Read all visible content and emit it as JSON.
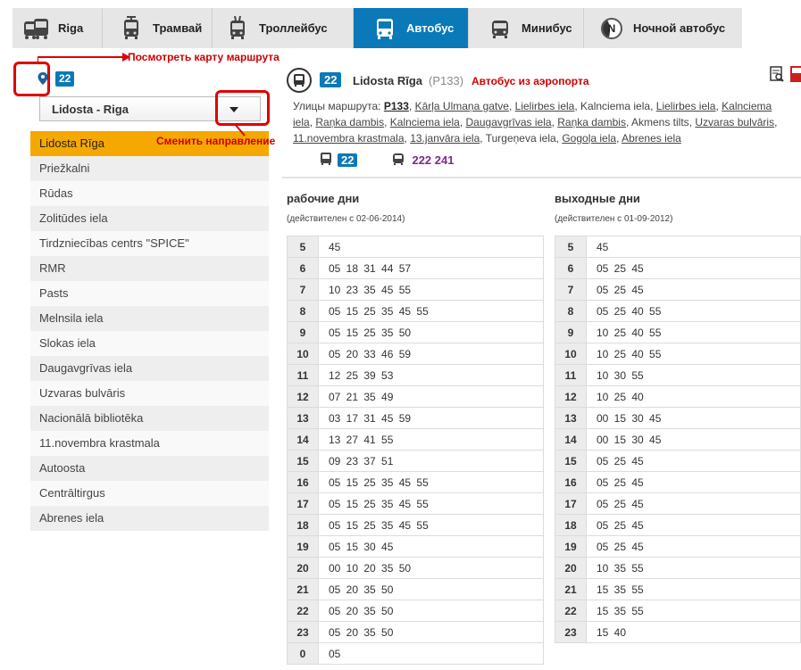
{
  "tabs": [
    {
      "label": "Riga",
      "icon": "bus-tram-icon"
    },
    {
      "label": "Трамвай",
      "icon": "tram-icon"
    },
    {
      "label": "Троллейбус",
      "icon": "trolleybus-icon"
    },
    {
      "label": "Автобус",
      "icon": "bus-icon",
      "active": true
    },
    {
      "label": "Минибус",
      "icon": "minibus-icon"
    },
    {
      "label": "Ночной автобус",
      "icon": "night-bus-icon",
      "icon_letter": "N"
    }
  ],
  "left": {
    "route_number": "22",
    "direction": "Lidosta - Riga",
    "stops": [
      "Lidosta Rīga",
      "Priežkalni",
      "Rūdas",
      "Zolitūdes iela",
      "Tirdzniecības centrs \"SPICE\"",
      "RMR",
      "Pasts",
      "Melnsila iela",
      "Slokas iela",
      "Daugavgrīvas iela",
      "Uzvaras bulvāris",
      "Nacionālā bibliotēka",
      "11.novembra krastmala",
      "Autoosta",
      "Centrāltirgus",
      "Abrenes iela"
    ],
    "active_stop": 0
  },
  "annotations": {
    "map_note": "Посмотреть карту маршрута",
    "direction_note": "Сменить направление"
  },
  "route": {
    "number": "22",
    "name": "Lidosta Rīga",
    "code": "(P133)",
    "note": "Автобус из аэропорта",
    "streets_label": "Улицы маршрута:",
    "streets_main": "P133",
    "streets": [
      {
        "text": "Kārļa Ulmaņa gatve",
        "link": true
      },
      {
        "text": "Lielirbes iela",
        "link": true
      },
      {
        "text": "Kalnciema iela",
        "link": false
      },
      {
        "text": "Lielirbes iela",
        "link": true
      },
      {
        "text": "Kalnciema iela",
        "link": true
      },
      {
        "text": "Raņka dambis",
        "link": true
      },
      {
        "text": "Kalnciema iela",
        "link": true
      },
      {
        "text": "Daugavgrīvas iela",
        "link": true
      },
      {
        "text": "Raņka dambis",
        "link": true
      },
      {
        "text": "Akmens tilts",
        "link": false
      },
      {
        "text": "Uzvaras bulvāris",
        "link": true
      },
      {
        "text": "11.novembra krastmala",
        "link": true
      },
      {
        "text": "13.janvāra iela",
        "link": true
      },
      {
        "text": "Turgeņeva iela",
        "link": false
      },
      {
        "text": "Gogoļa iela",
        "link": true
      },
      {
        "text": "Abrenes iela",
        "link": true
      }
    ],
    "transfer_bus": "22",
    "transfer_minibus": "222  241"
  },
  "colors": {
    "accent": "#0a79b8",
    "active_stop": "#f5a800",
    "alert": "#cc0000",
    "minibus": "#7b2a8c"
  },
  "weekdays": {
    "title": "рабочие дни",
    "valid": "(действителен с 02-06-2014)",
    "rows": [
      [
        "5",
        "45"
      ],
      [
        "6",
        "05 18 31 44 57"
      ],
      [
        "7",
        "10 23 35 45 55"
      ],
      [
        "8",
        "05 15 25 35 45 55"
      ],
      [
        "9",
        "05 15 25 35 50"
      ],
      [
        "10",
        "05 20 33 46 59"
      ],
      [
        "11",
        "12 25 39 53"
      ],
      [
        "12",
        "07 21 35 49"
      ],
      [
        "13",
        "03 17 31 45 59"
      ],
      [
        "14",
        "13 27 41 55"
      ],
      [
        "15",
        "09 23 37 51"
      ],
      [
        "16",
        "05 15 25 35 45 55"
      ],
      [
        "17",
        "05 15 25 35 45 55"
      ],
      [
        "18",
        "05 15 25 35 45 55"
      ],
      [
        "19",
        "05 15 30 45"
      ],
      [
        "20",
        "00 10 20 35 50"
      ],
      [
        "21",
        "05 20 35 50"
      ],
      [
        "22",
        "05 20 35 50"
      ],
      [
        "23",
        "05 20 35 50"
      ],
      [
        "0",
        "05"
      ]
    ]
  },
  "weekends": {
    "title": "выходные дни",
    "valid": "(действителен с 01-09-2012)",
    "rows": [
      [
        "5",
        "45"
      ],
      [
        "6",
        "05 25 45"
      ],
      [
        "7",
        "05 25 45"
      ],
      [
        "8",
        "05 25 40 55"
      ],
      [
        "9",
        "10 25 40 55"
      ],
      [
        "10",
        "10 25 40 55"
      ],
      [
        "11",
        "10 30 55"
      ],
      [
        "12",
        "10 25 40"
      ],
      [
        "13",
        "00 15 30 45"
      ],
      [
        "14",
        "00 15 30 45"
      ],
      [
        "15",
        "05 25 45"
      ],
      [
        "16",
        "05 25 45"
      ],
      [
        "17",
        "05 25 45"
      ],
      [
        "18",
        "05 25 45"
      ],
      [
        "19",
        "05 25 45"
      ],
      [
        "20",
        "10 35 55"
      ],
      [
        "21",
        "15 35 55"
      ],
      [
        "22",
        "15 35 55"
      ],
      [
        "23",
        "15 40"
      ]
    ]
  }
}
